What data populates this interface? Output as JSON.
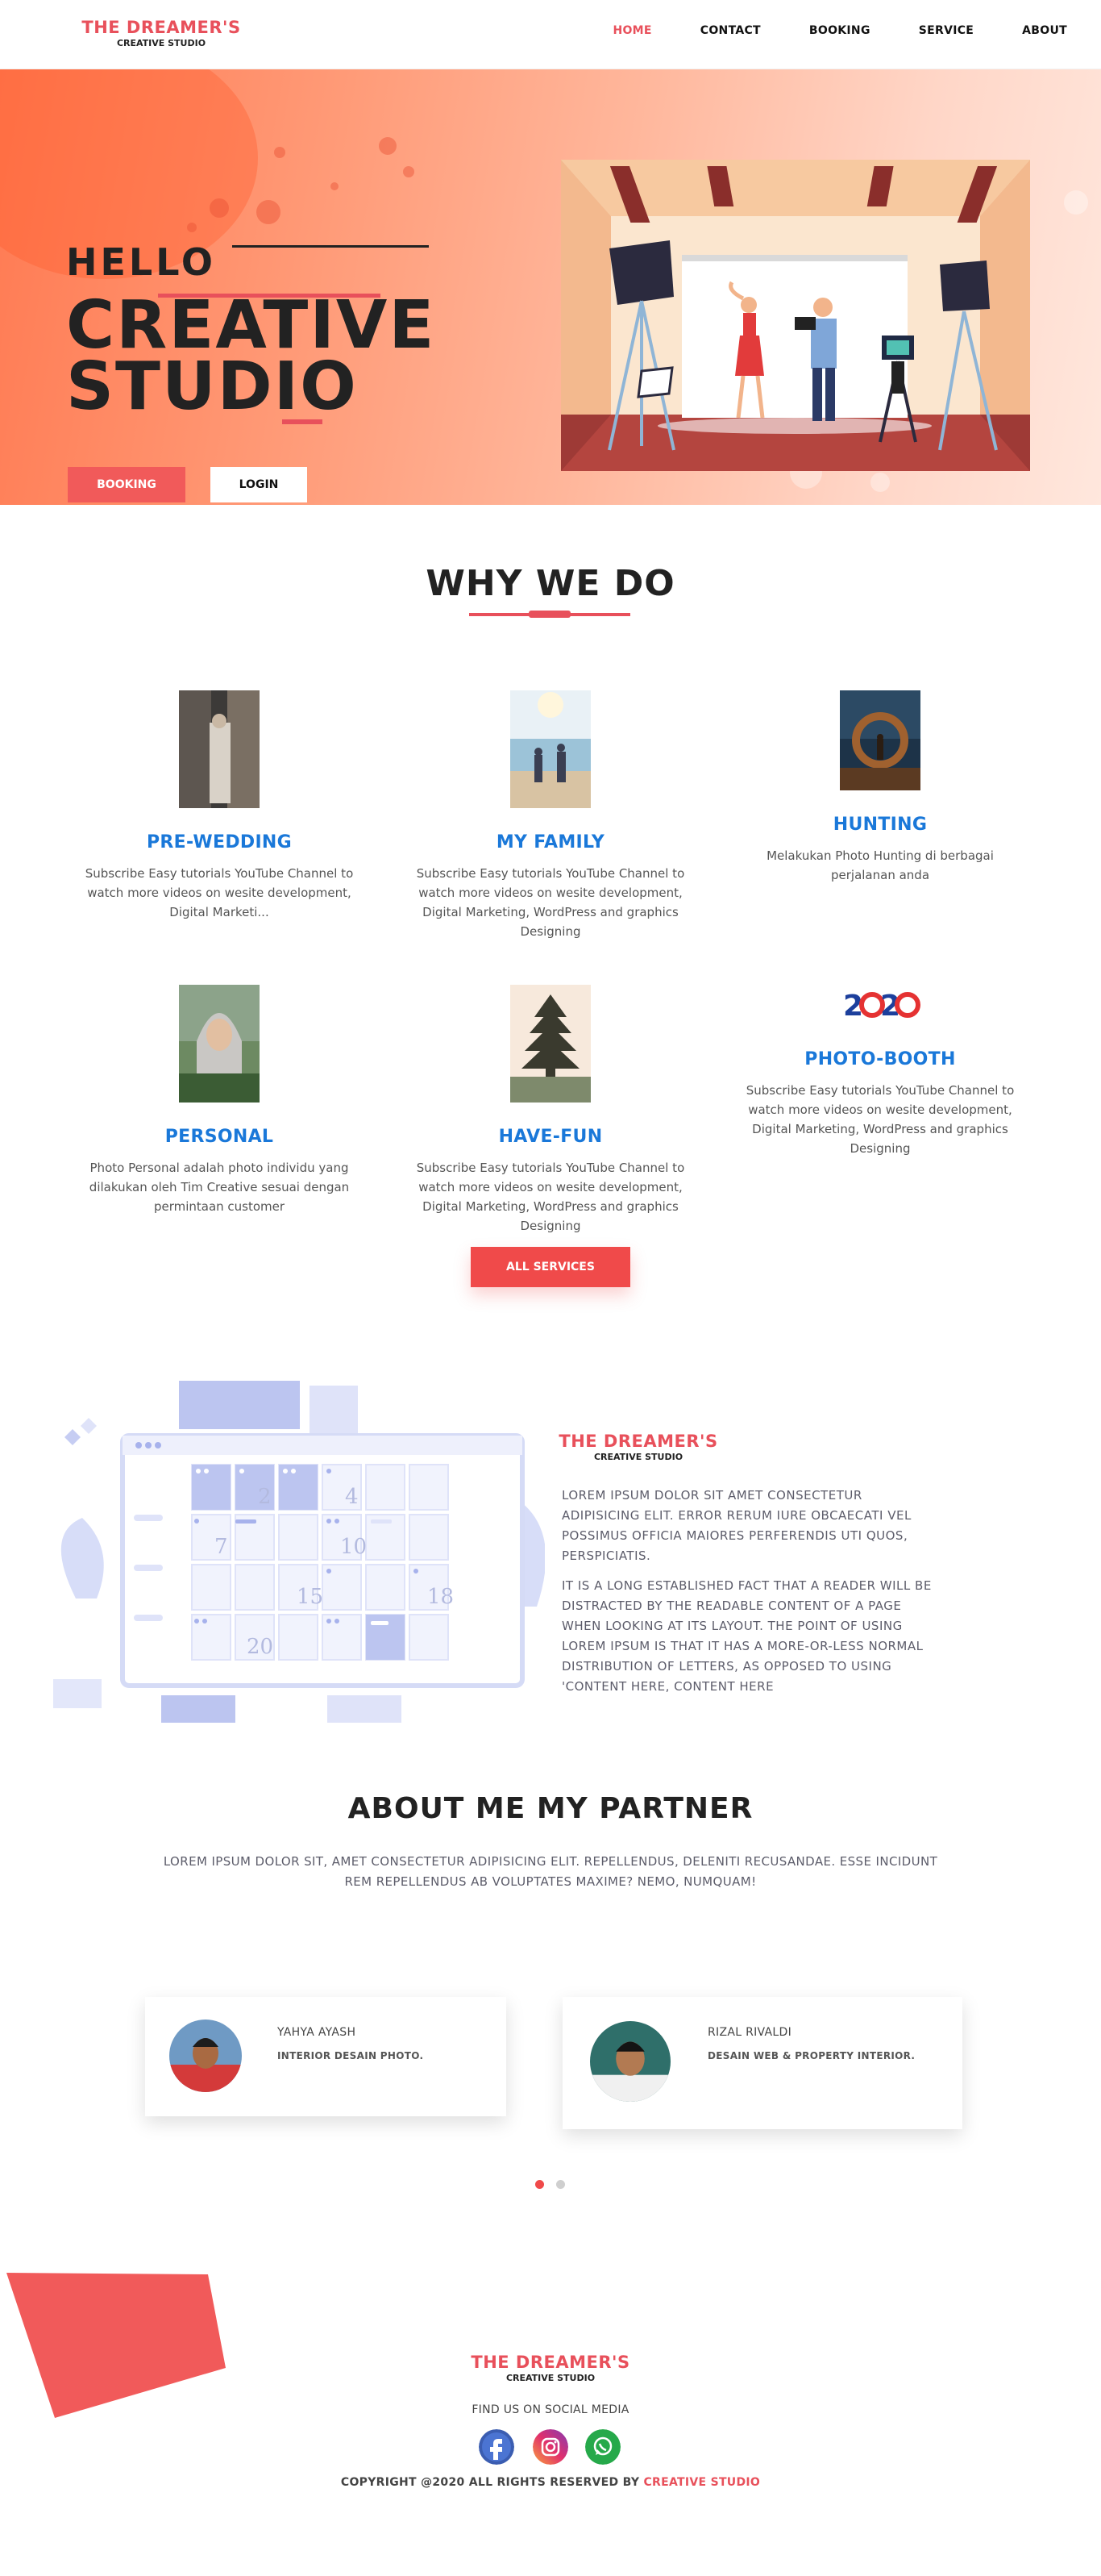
{
  "brand": {
    "name": "THE DREAMER'S",
    "tagline": "CREATIVE STUDIO"
  },
  "nav": {
    "items": [
      "HOME",
      "CONTACT",
      "BOOKING",
      "SERVICE",
      "ABOUT"
    ],
    "active": "HOME"
  },
  "hero": {
    "hello": "HELLO",
    "title_line1": "CREATIVE",
    "title_line2": "STUDIO",
    "booking_label": "BOOKING",
    "login_label": "LOGIN"
  },
  "why": {
    "title": "WHY WE DO",
    "services": [
      {
        "title": "PRE-WEDDING",
        "desc": "Subscribe Easy tutorials YouTube Channel to watch more videos on wesite development, Digital Marketi..."
      },
      {
        "title": "MY FAMILY",
        "desc": "Subscribe Easy tutorials YouTube Channel to watch more videos on wesite development, Digital Marketing, WordPress and graphics Designing"
      },
      {
        "title": "HUNTING",
        "desc": "Melakukan Photo Hunting di berbagai perjalanan anda"
      },
      {
        "title": "PERSONAL",
        "desc": "Photo Personal adalah photo individu yang dilakukan oleh Tim Creative sesuai dengan permintaan customer"
      },
      {
        "title": "HAVE-FUN",
        "desc": "Subscribe Easy tutorials YouTube Channel to watch more videos on wesite development, Digital Marketing, WordPress and graphics Designing"
      },
      {
        "title": "PHOTO-BOOTH",
        "desc": "Subscribe Easy tutorials YouTube Channel to watch more videos on wesite development, Digital Marketing, WordPress and graphics Designing"
      }
    ],
    "all_services_label": "ALL SERVICES"
  },
  "about": {
    "para1": "LOREM IPSUM DOLOR SIT AMET CONSECTETUR ADIPISICING ELIT. ERROR RERUM IURE OBCAECATI VEL POSSIMUS OFFICIA MAIORES PERFERENDIS UTI QUOS, PERSPICIATIS.",
    "para2": "IT IS A LONG ESTABLISHED FACT THAT A READER WILL BE DISTRACTED BY THE READABLE CONTENT OF A PAGE WHEN LOOKING AT ITS LAYOUT. THE POINT OF USING LOREM IPSUM IS THAT IT HAS A MORE-OR-LESS NORMAL DISTRIBUTION OF LETTERS, AS OPPOSED TO USING 'CONTENT HERE, CONTENT HERE",
    "calendar_numbers": [
      "2",
      "4",
      "7",
      "10",
      "15",
      "18",
      "20"
    ]
  },
  "partners": {
    "title": "ABOUT ME MY PARTNER",
    "subtitle": "LOREM IPSUM DOLOR SIT, AMET CONSECTETUR ADIPISICING ELIT. REPELLENDUS, DELENITI RECUSANDAE. ESSE INCIDUNT REM REPELLENDUS AB VOLUPTATES MAXIME? NEMO, NUMQUAM!",
    "people": [
      {
        "name": "YAHYA AYASH",
        "role": "INTERIOR DESAIN PHOTO."
      },
      {
        "name": "RIZAL RIVALDI",
        "role": "DESAIN WEB & PROPERTY INTERIOR."
      }
    ],
    "carousel_active": 1,
    "carousel_total": 2
  },
  "footer": {
    "find_us": "FIND US ON SOCIAL MEDIA",
    "social": [
      "facebook-icon",
      "instagram-icon",
      "whatsapp-icon"
    ],
    "copyright_prefix": "COPYRIGHT @2020 ALL RIGHTS RESERVED BY ",
    "copyright_brand": "CREATIVE STUDIO"
  },
  "colors": {
    "accent": "#e8505b",
    "link_blue": "#1a78d9",
    "button_red": "#f04a4a"
  }
}
